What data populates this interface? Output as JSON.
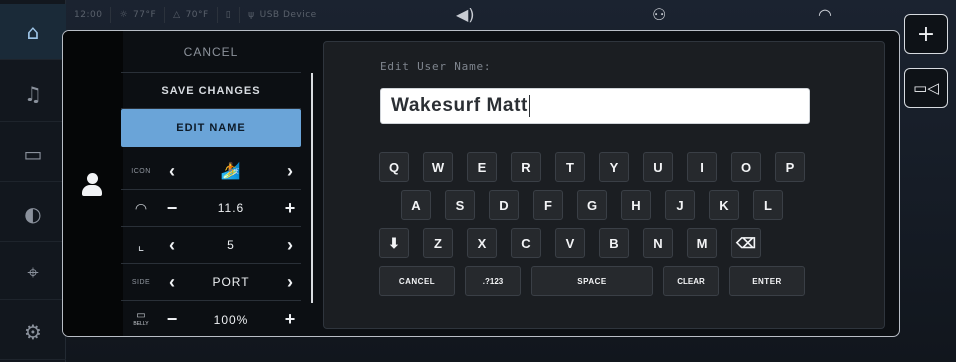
{
  "status_bar": {
    "time": "12:00",
    "air_temp": "77°F",
    "water_temp": "70°F",
    "usb_label": "USB Device"
  },
  "left_nav": {
    "items": [
      "home-icon",
      "music-icon",
      "ballast-icon",
      "toggle-icon",
      "map-pin-icon",
      "gear-icon"
    ]
  },
  "right_nav": {
    "add_label": "+",
    "camera": "camera-icon"
  },
  "menu": {
    "cancel": "CANCEL",
    "save": "SAVE CHANGES",
    "edit_name": "EDIT NAME",
    "icon_label": "ICON",
    "speed_value": "11.6",
    "wave_value": "5",
    "side_label": "SIDE",
    "side_value": "PORT",
    "belly_value": "100%",
    "belly_label": "BELLY"
  },
  "editor": {
    "title": "Edit User Name:",
    "name_value": "Wakesurf Matt"
  },
  "keyboard": {
    "row1": [
      "Q",
      "W",
      "E",
      "R",
      "T",
      "Y",
      "U",
      "I",
      "O",
      "P"
    ],
    "row2": [
      "A",
      "S",
      "D",
      "F",
      "G",
      "H",
      "J",
      "K",
      "L"
    ],
    "row3": [
      "Z",
      "X",
      "C",
      "V",
      "B",
      "N",
      "M"
    ],
    "cancel": "CANCEL",
    "numeric": ".?123",
    "space": "SPACE",
    "clear": "CLEAR",
    "enter": "ENTER"
  }
}
